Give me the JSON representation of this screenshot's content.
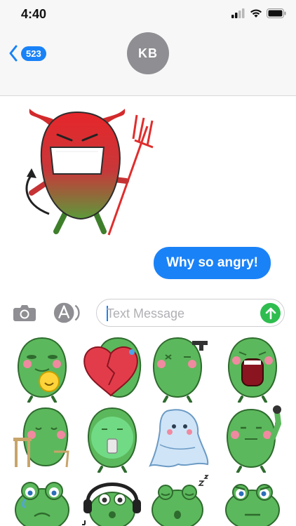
{
  "status_bar": {
    "time": "4:40"
  },
  "header": {
    "back_count": "523",
    "contact_initials": "KB"
  },
  "conversation": {
    "outgoing_message": "Why so angry!"
  },
  "input_bar": {
    "placeholder": "Text Message"
  },
  "colors": {
    "imessage_blue": "#1a82f7",
    "send_green": "#2fbd4f",
    "frog_green": "#5cb85c",
    "devil_red": "#e3342f"
  },
  "sticker_tray": {
    "stickers": [
      "frog-holding-smiley-sticker",
      "frog-broken-heart-sticker",
      "frog-with-gun-sticker",
      "frog-screaming-sticker",
      "frog-hiding-at-desk-sticker",
      "frog-sick-glowing-sticker",
      "ghost-sticker",
      "frog-flexing-sticker",
      "frog-crying-sticker",
      "frog-headphones-music-sticker",
      "frog-sleeping-sticker",
      "frog-annoyed-sticker"
    ]
  },
  "icons": {
    "camera": "camera-icon",
    "app_store": "app-store-icon",
    "send": "arrow-up-icon",
    "back": "chevron-left-icon"
  }
}
